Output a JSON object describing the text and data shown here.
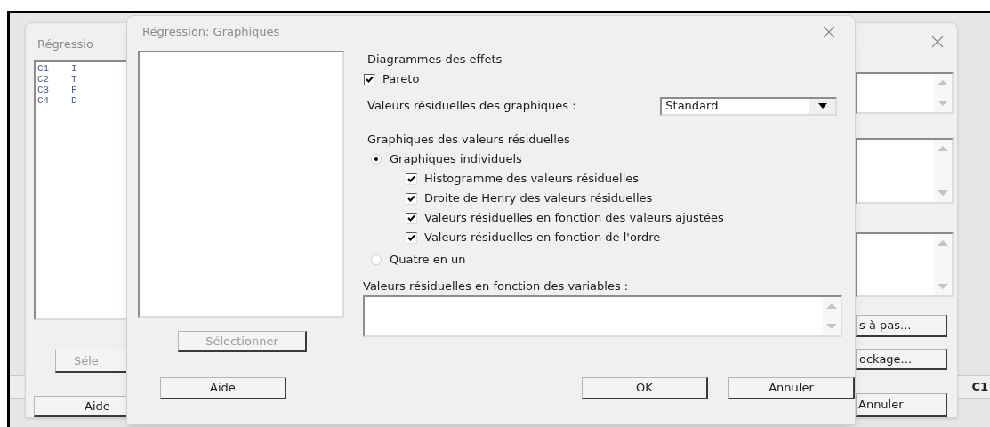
{
  "worksheet": {
    "column_header": "C1"
  },
  "background_dialog": {
    "title": "Régressio",
    "variables": [
      {
        "column": "C1",
        "name": "I"
      },
      {
        "column": "C2",
        "name": "T"
      },
      {
        "column": "C3",
        "name": "F"
      },
      {
        "column": "C4",
        "name": "D"
      }
    ],
    "select_button": {
      "label": "Séle",
      "disabled": true
    },
    "side_buttons": [
      {
        "label": "s à pas...",
        "disabled": false
      },
      {
        "label": "ockage...",
        "disabled": false
      }
    ],
    "help_button": {
      "label": "Aide",
      "disabled": false
    },
    "cancel_button": {
      "label": "Annuler",
      "disabled": false
    }
  },
  "dialog": {
    "title": "Régression: Graphiques",
    "select_button": {
      "label": "Sélectionner",
      "disabled": true
    },
    "effects_plots": {
      "heading": "Diagrammes des effets",
      "options": [
        {
          "label": "Pareto",
          "checked": true
        }
      ]
    },
    "residuals_for_plots": {
      "label": "Valeurs résiduelles des graphiques :",
      "value": "Standard"
    },
    "residual_plots": {
      "heading": "Graphiques des valeurs résiduelles",
      "options": [
        {
          "label": "Graphiques individuels",
          "selected": true,
          "children": [
            {
              "label": "Histogramme des valeurs résiduelles",
              "checked": true
            },
            {
              "label": "Droite de Henry des valeurs résiduelles",
              "checked": true
            },
            {
              "label": "Valeurs résiduelles en fonction des valeurs ajustées",
              "checked": true
            },
            {
              "label": "Valeurs résiduelles en fonction de l'ordre",
              "checked": true
            }
          ]
        },
        {
          "label": "Quatre en un",
          "selected": false
        }
      ]
    },
    "residuals_vs_variables": {
      "label": "Valeurs résiduelles en fonction des variables :"
    },
    "buttons": [
      {
        "label": "Aide",
        "disabled": false
      },
      {
        "label": "OK",
        "disabled": false
      },
      {
        "label": "Annuler",
        "disabled": false
      }
    ]
  }
}
